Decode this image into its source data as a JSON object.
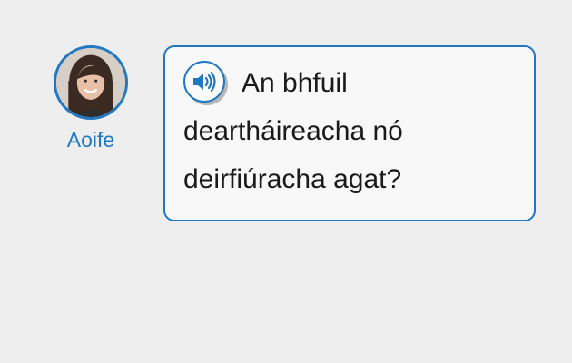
{
  "speaker": {
    "name": "Aoife",
    "avatar_icon": "person-photo"
  },
  "bubble": {
    "audio_icon": "speaker-volume-icon",
    "text": "An bhfuil deartháireacha nó deirfiúracha agat?"
  },
  "colors": {
    "accent": "#1f78c1",
    "background": "#eeeeee",
    "bubble_background": "#f8f8f8",
    "text": "#1a1a1a"
  }
}
